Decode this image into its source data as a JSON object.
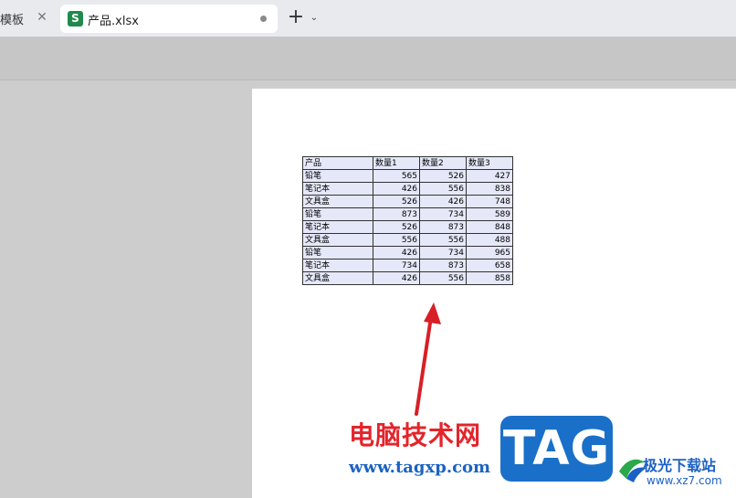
{
  "tabs": [
    {
      "label": "模板",
      "has_close": true
    },
    {
      "label": "产品.xlsx",
      "icon_letter": "S",
      "active": true,
      "unsaved_dot": true
    }
  ],
  "tab_bar": {
    "new_tab_symbol": "+",
    "menu_symbol": "⌄"
  },
  "table": {
    "headers": [
      "产品",
      "数量1",
      "数量2",
      "数量3"
    ],
    "rows": [
      [
        "铅笔",
        "565",
        "526",
        "427"
      ],
      [
        "笔记本",
        "426",
        "556",
        "838"
      ],
      [
        "文具盒",
        "526",
        "426",
        "748"
      ],
      [
        "铅笔",
        "873",
        "734",
        "589"
      ],
      [
        "笔记本",
        "526",
        "873",
        "848"
      ],
      [
        "文具盒",
        "556",
        "556",
        "488"
      ],
      [
        "铅笔",
        "426",
        "734",
        "965"
      ],
      [
        "笔记本",
        "734",
        "873",
        "658"
      ],
      [
        "文具盒",
        "426",
        "556",
        "858"
      ]
    ]
  },
  "watermark": {
    "cn_text": "电脑技术网",
    "url": "www.tagxp.com",
    "logo_text": "TAG",
    "partner_text": "极光下载站",
    "partner_url": "www.xz7.com"
  },
  "colors": {
    "accent_red": "#e4242b",
    "brand_blue": "#1a70c8",
    "sheet_green": "#1f8a4c",
    "cell_fill": "#e4e8f8"
  }
}
